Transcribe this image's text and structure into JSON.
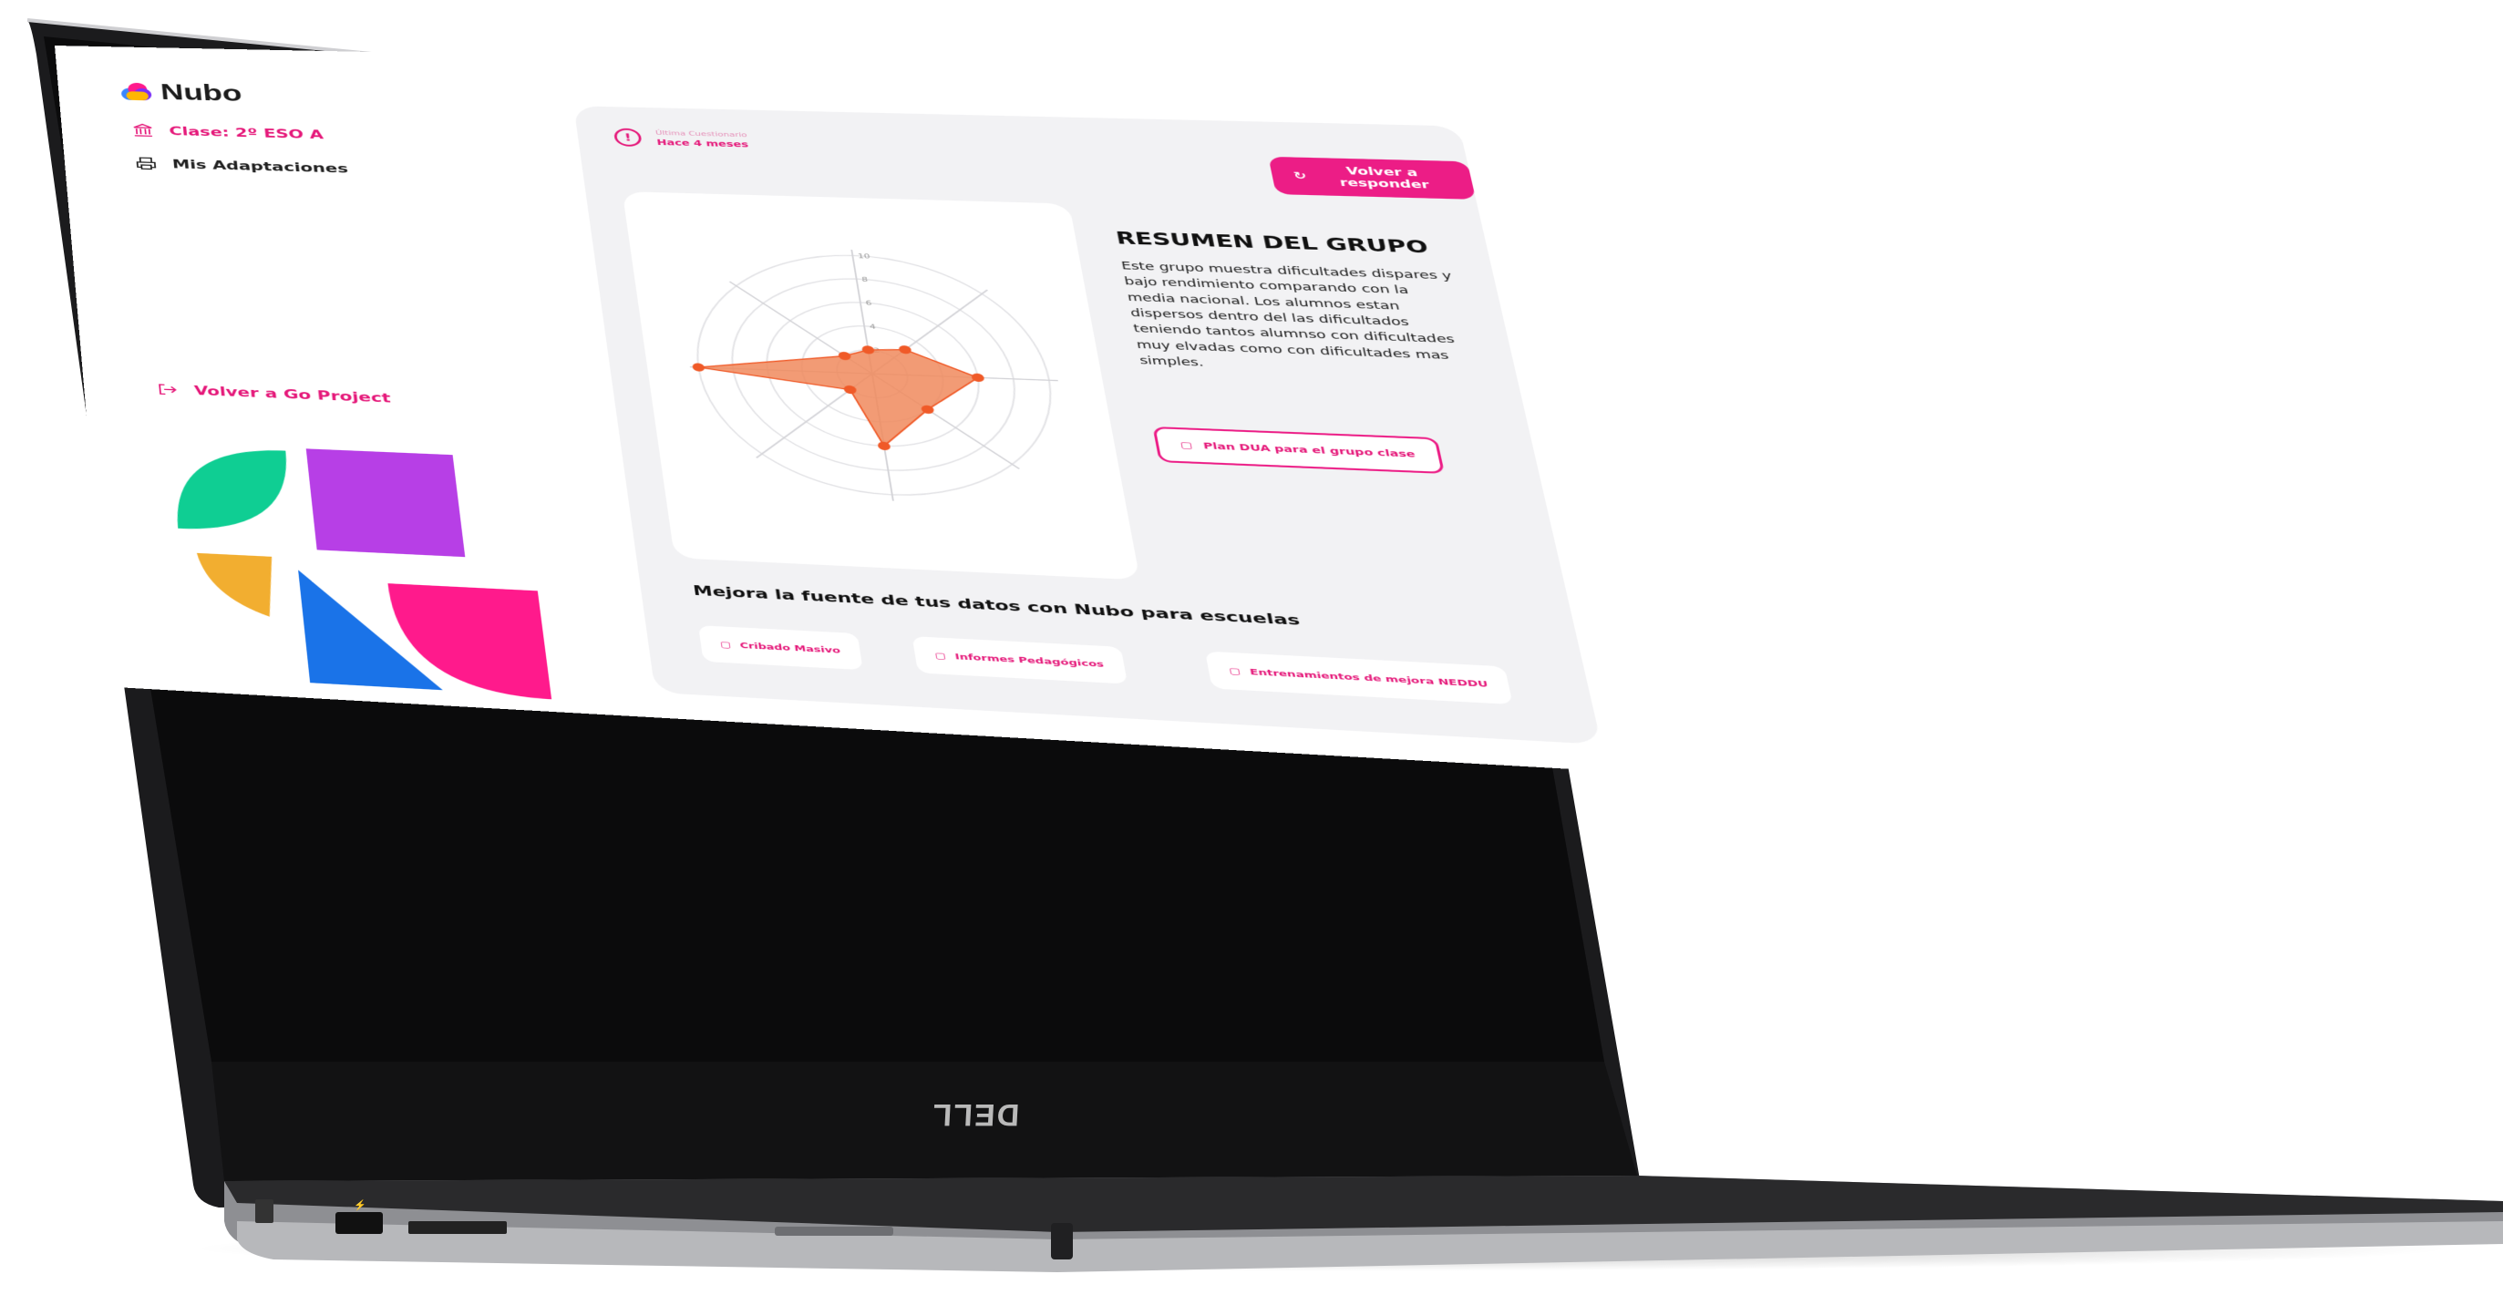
{
  "device": {
    "brand": "DELL"
  },
  "app": {
    "name": "Nubo"
  },
  "sidebar": {
    "class_label": "Clase: 2º ESO A",
    "adaptations_label": "Mis Adaptaciones",
    "back_label": "Volver a Go Project"
  },
  "survey": {
    "label": "Última Cuestionario",
    "value": "Hace 4 meses"
  },
  "actions": {
    "retake_label": "Volver a responder"
  },
  "summary": {
    "title": "RESUMEN DEL GRUPO",
    "body": "Este grupo muestra dificultades dispares y bajo rendimiento comparando con la media nacional. Los alumnos estan dispersos dentro del las dificultados teniendo tantos alumnso con dificultades muy elvadas como con dificultades mas simples.",
    "plan_button": "Plan DUA para el grupo clase"
  },
  "chart_data": {
    "type": "radar",
    "axes_count": 8,
    "scale": [
      0,
      10
    ],
    "ticks": [
      "2",
      "4",
      "6",
      "8",
      "10"
    ],
    "series": [
      {
        "values": [
          2,
          3,
          6,
          4,
          6,
          2,
          10,
          2
        ]
      }
    ],
    "grid": true,
    "fill_color": "#f08a5d",
    "stroke_color": "#f05a28"
  },
  "improve": {
    "title": "Mejora la fuente de tus datos con Nubo para escuelas",
    "items": [
      {
        "label": "Cribado Masivo"
      },
      {
        "label": "Informes Pedagógicos"
      },
      {
        "label": "Entrenamientos de mejora NEDDU"
      }
    ]
  },
  "colors": {
    "accent": "#ec1d86",
    "panel": "#f2f2f4",
    "shape_green": "#0fce93",
    "shape_purple": "#b73fe6",
    "shape_yellow": "#f2ae30",
    "shape_blue": "#1a73e8",
    "shape_pink": "#ff1a8c"
  }
}
